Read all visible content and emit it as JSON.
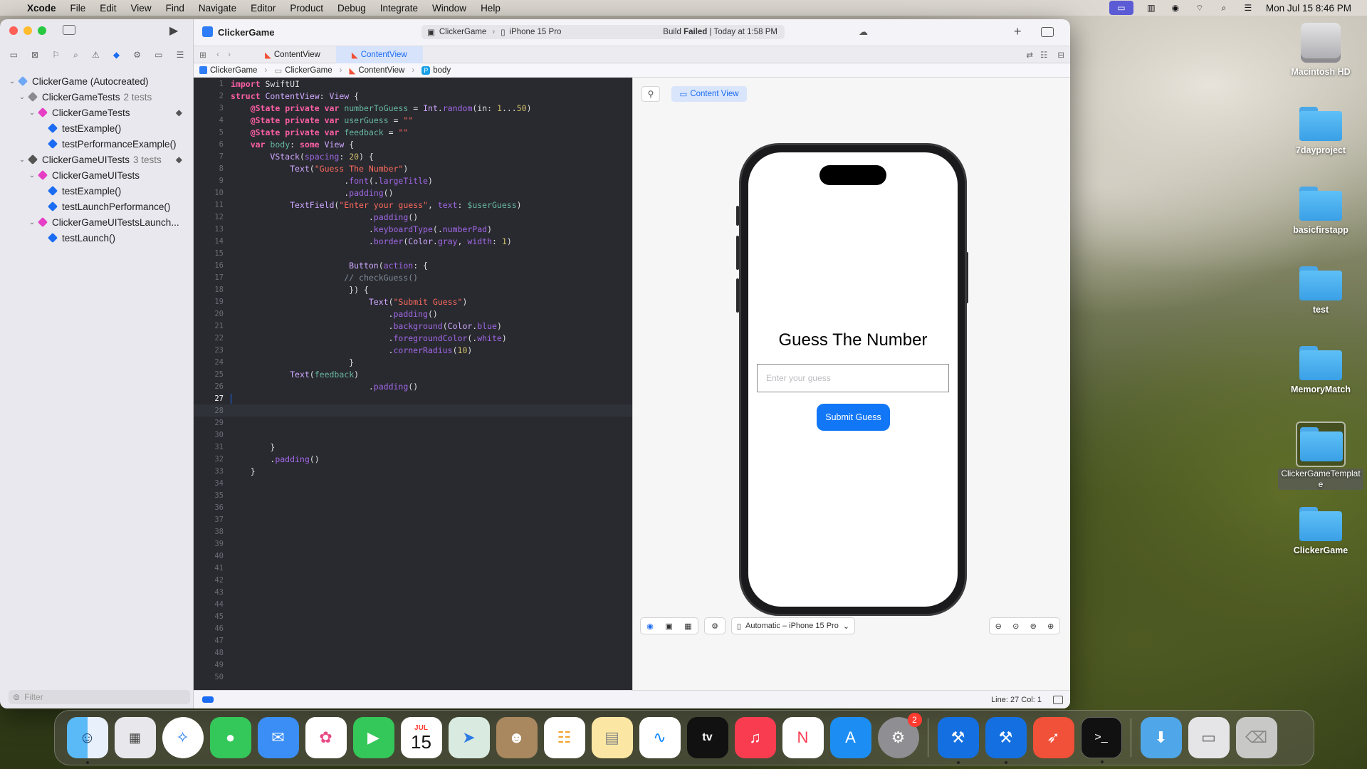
{
  "menubar": {
    "app": "Xcode",
    "items": [
      "File",
      "Edit",
      "View",
      "Find",
      "Navigate",
      "Editor",
      "Product",
      "Debug",
      "Integrate",
      "Window",
      "Help"
    ],
    "clock": "Mon Jul 15  8:46 PM"
  },
  "toolbar": {
    "project": "ClickerGame",
    "scheme": "ClickerGame",
    "device": "iPhone 15 Pro",
    "status_prefix": "Build",
    "status_bold": "Failed",
    "status_suffix": "| Today at 1:58 PM"
  },
  "tabs": [
    {
      "label": "ContentView"
    },
    {
      "label": "ContentView"
    }
  ],
  "breadcrumb": [
    "ClickerGame",
    "ClickerGame",
    "ContentView",
    "body"
  ],
  "navigator": {
    "items": [
      {
        "label": "ClickerGame (Autocreated)",
        "sub": ""
      },
      {
        "label": "ClickerGameTests",
        "sub": "2 tests"
      },
      {
        "label": "ClickerGameTests",
        "sub": ""
      },
      {
        "label": "testExample()",
        "sub": ""
      },
      {
        "label": "testPerformanceExample()",
        "sub": ""
      },
      {
        "label": "ClickerGameUITests",
        "sub": "3 tests"
      },
      {
        "label": "ClickerGameUITests",
        "sub": ""
      },
      {
        "label": "testExample()",
        "sub": ""
      },
      {
        "label": "testLaunchPerformance()",
        "sub": ""
      },
      {
        "label": "ClickerGameUITestsLaunch...",
        "sub": ""
      },
      {
        "label": "testLaunch()",
        "sub": ""
      }
    ],
    "filter_placeholder": "Filter"
  },
  "editor": {
    "line_count": 50,
    "current_line": 27
  },
  "canvas": {
    "preview_tab": "Content View",
    "device_selector": "Automatic – iPhone 15 Pro",
    "app": {
      "title": "Guess The Number",
      "placeholder": "Enter your guess",
      "button": "Submit Guess"
    }
  },
  "status": {
    "position": "Line: 27  Col: 1"
  },
  "desktop": [
    {
      "label": "Macintosh HD",
      "kind": "disk"
    },
    {
      "label": "7dayproject",
      "kind": "folder"
    },
    {
      "label": "basicfirstapp",
      "kind": "folder"
    },
    {
      "label": "test",
      "kind": "folder"
    },
    {
      "label": "MemoryMatch",
      "kind": "folder"
    },
    {
      "label": "ClickerGameTemplate",
      "kind": "folder"
    },
    {
      "label": "ClickerGame",
      "kind": "folder"
    }
  ],
  "dock": {
    "calendar_month": "JUL",
    "calendar_day": "15",
    "settings_badge": "2",
    "tv_label": "tv"
  },
  "colors": {
    "accent": "#1b6cf2",
    "editor_bg": "#292a30",
    "button_blue": "#1277f6",
    "keyword": "#fc5fa3",
    "string": "#fc6a5d"
  }
}
